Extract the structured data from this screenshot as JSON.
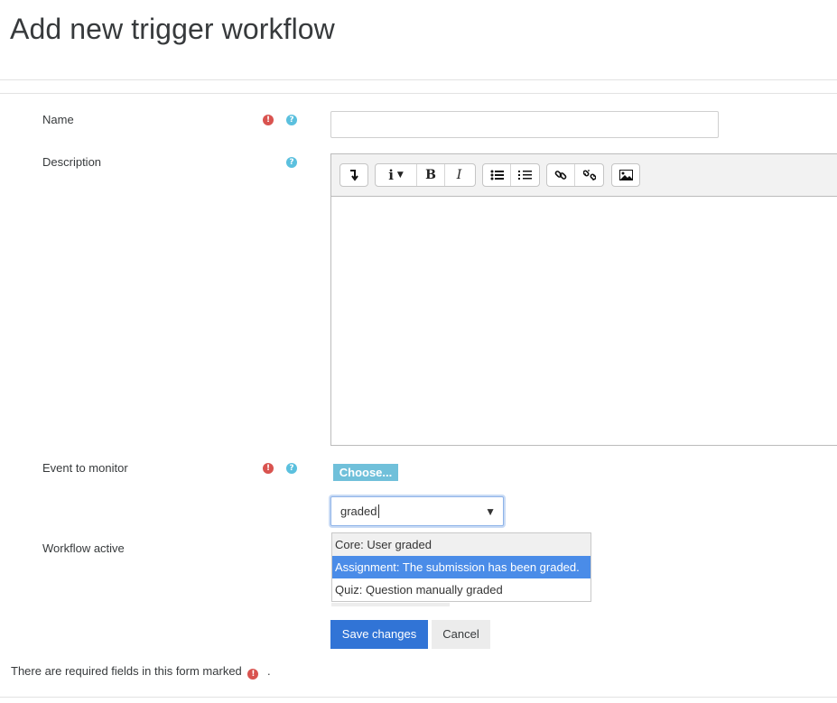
{
  "page": {
    "title": "Add new trigger workflow"
  },
  "form": {
    "name": {
      "label": "Name",
      "value": ""
    },
    "description": {
      "label": "Description",
      "toolbar_icons": [
        "collapse-icon",
        "info-icon",
        "bold-icon",
        "italic-icon",
        "unordered-list-icon",
        "ordered-list-icon",
        "link-icon",
        "unlink-icon",
        "image-icon"
      ],
      "value": ""
    },
    "event": {
      "label": "Event to monitor",
      "choose_label": "Choose...",
      "search_value": "graded",
      "options": [
        "Core: User graded",
        "Assignment: The submission has been graded.",
        "Quiz: Question manually graded"
      ],
      "selected_option": "Assignment: The submission has been graded."
    },
    "workflow_active": {
      "label": "Workflow active"
    }
  },
  "buttons": {
    "save": "Save changes",
    "cancel": "Cancel"
  },
  "footer": {
    "required_note": "There are required fields in this form marked",
    "required_note_suffix": "."
  },
  "colors": {
    "required": "#d9534f",
    "help": "#5bc0de",
    "primary": "#3174d6",
    "selected_option": "#4a8ce8"
  }
}
